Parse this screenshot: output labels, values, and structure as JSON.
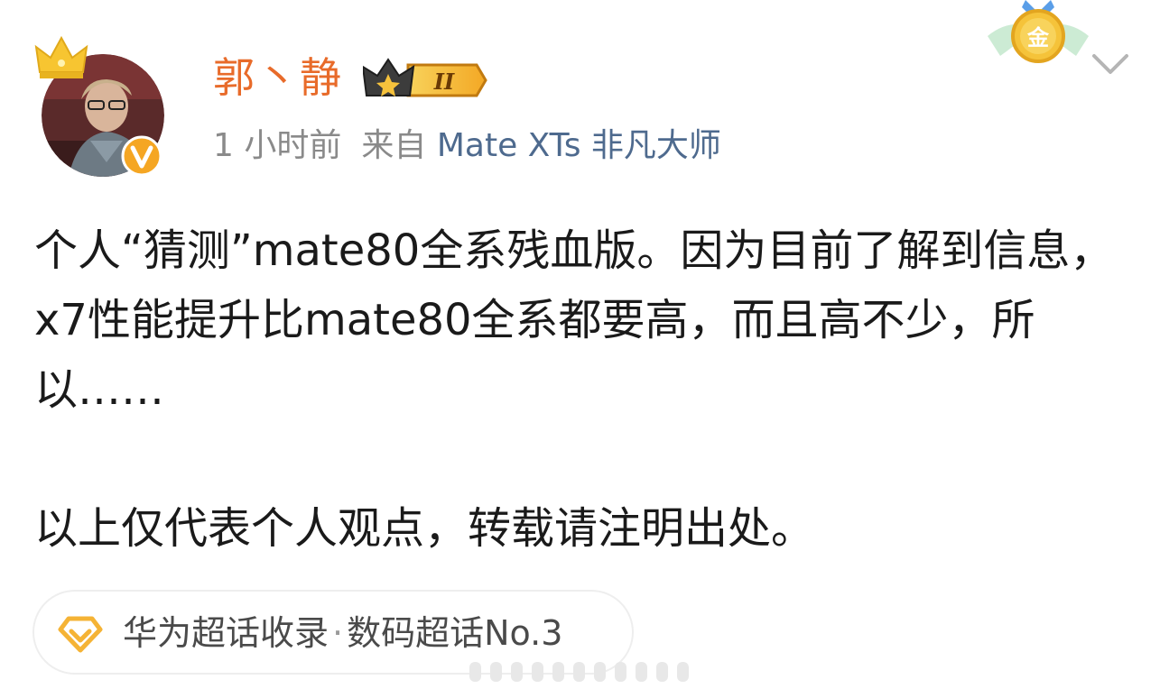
{
  "user": {
    "name": "郭丶静",
    "level_badge": "II",
    "avatar_verified_mark": "v"
  },
  "meta": {
    "time": "1 小时前",
    "from_label": "来自",
    "source": "Mate XTs 非凡大师"
  },
  "medal": {
    "label": "金"
  },
  "post": {
    "paragraph1": "个人“猜测”mate80全系残血版。因为目前了解到信息，x7性能提升比mate80全系都要高，而且高不少，所以……",
    "paragraph2": "以上仅代表个人观点，转载请注明出处。"
  },
  "topic": {
    "name": "华为超话收录",
    "separator": "·",
    "rank": "数码超话No.3"
  },
  "colors": {
    "username": "#e86b2a",
    "source_link": "#4e6a8e",
    "meta_gray": "#8a8a8a",
    "verified_badge": "#f5a623",
    "topic_icon": "#f5b335"
  },
  "icons": {
    "crown_deco": "crown-icon",
    "verified": "verified-badge-icon",
    "level": "vip-crown-icon",
    "medal": "gold-medal-icon",
    "more": "chevron-down-icon",
    "topic": "diamond-icon"
  }
}
